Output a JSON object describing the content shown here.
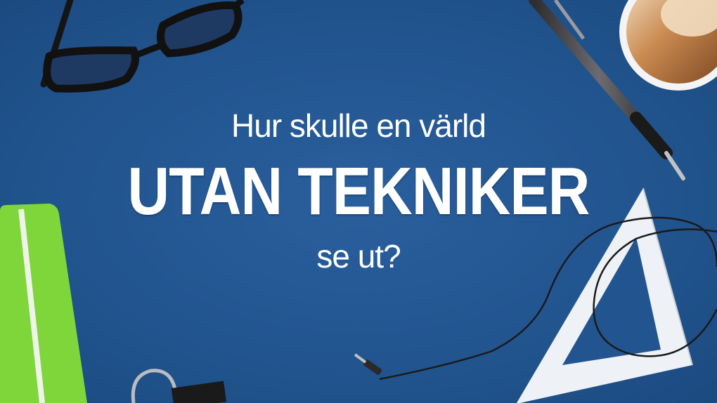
{
  "headline": {
    "line1": "Hur skulle en värld",
    "line2": "UTAN TEKNIKER",
    "line3": "se ut?"
  },
  "colors": {
    "background": "#22558f",
    "text": "#ffffff",
    "notebook": "#7fd63a"
  },
  "icons": [
    "glasses-icon",
    "pen-icon",
    "coffee-cup-icon",
    "notebook-icon",
    "binder-clip-icon",
    "set-square-icon",
    "audio-cable-icon"
  ]
}
